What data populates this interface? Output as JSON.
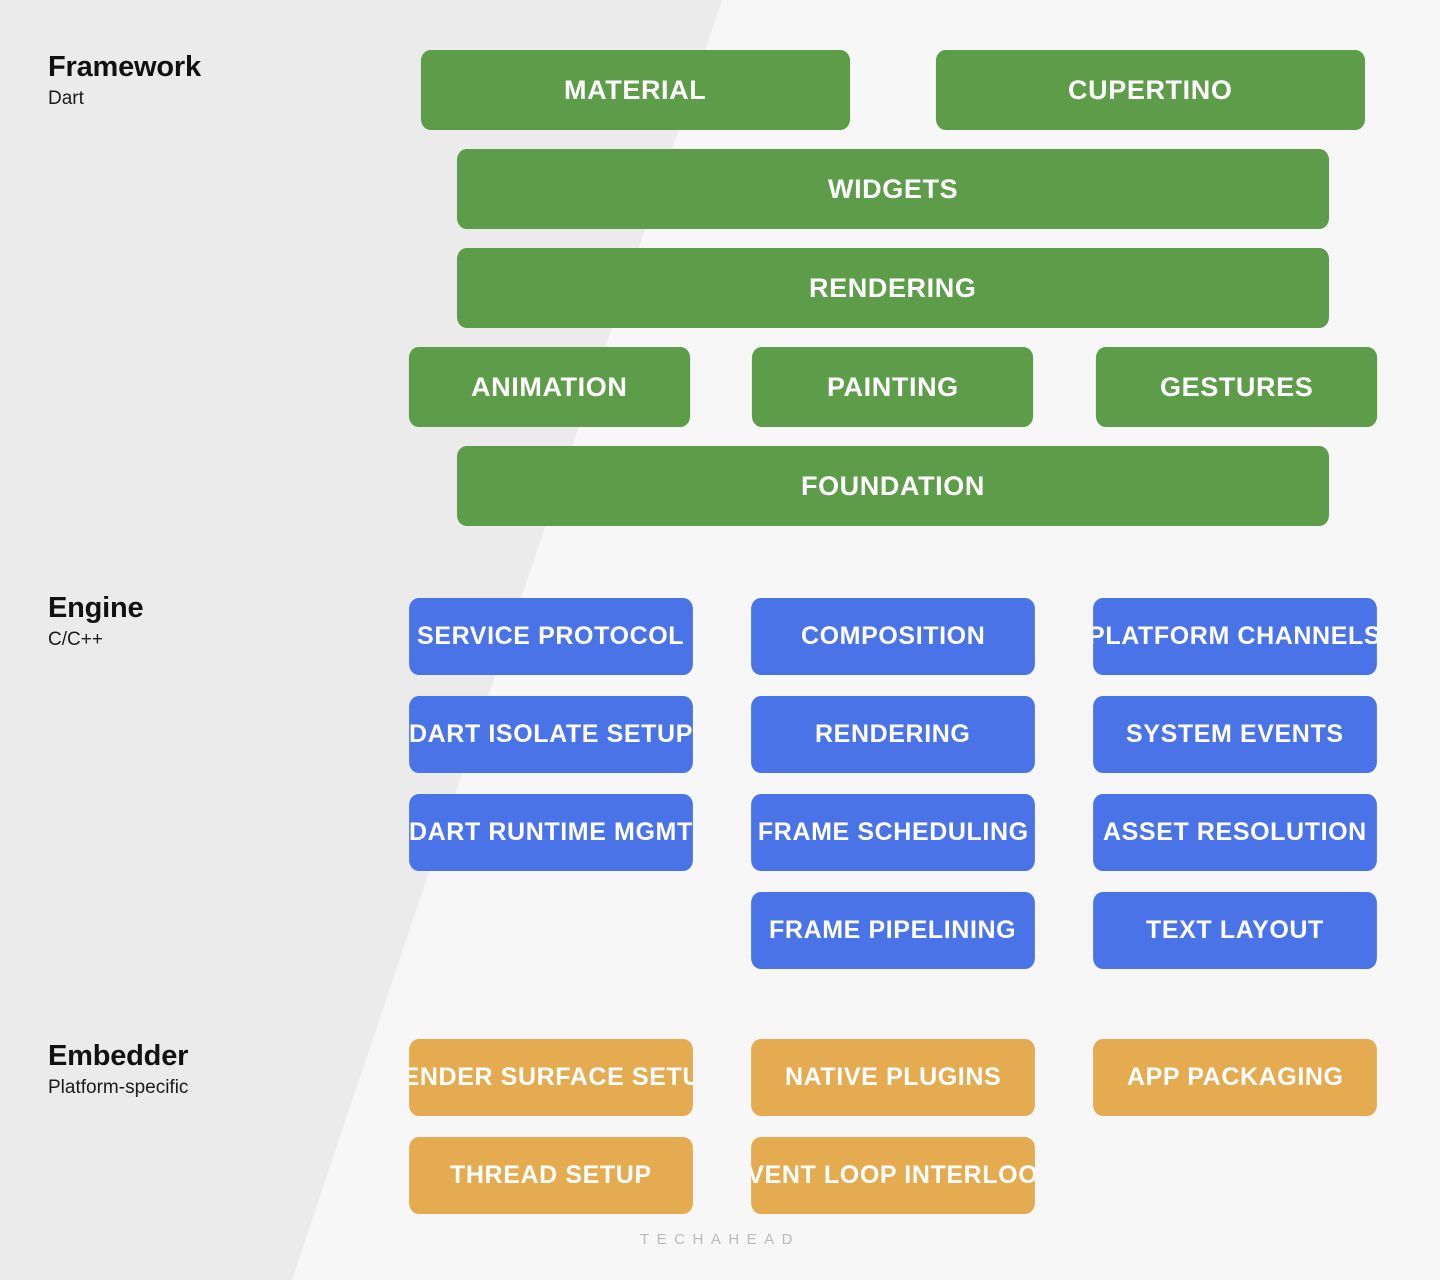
{
  "theme": {
    "bg_left": "#ebebeb",
    "bg_right": "#f7f7f7",
    "framework_color": "#5d9c48",
    "engine_color": "#4a73e8",
    "embedder_color": "#e5ab50",
    "box_text_color": "#ffffff",
    "label_text_color": "#111111",
    "watermark_color": "#b9b9b9"
  },
  "sections": {
    "framework": {
      "title": "Framework",
      "subtitle": "Dart",
      "rows": [
        [
          {
            "label": "MATERIAL",
            "width": "half"
          },
          {
            "label": "CUPERTINO",
            "width": "half"
          }
        ],
        [
          {
            "label": "WIDGETS",
            "width": "full"
          }
        ],
        [
          {
            "label": "RENDERING",
            "width": "full"
          }
        ],
        [
          {
            "label": "ANIMATION",
            "width": "third"
          },
          {
            "label": "PAINTING",
            "width": "third"
          },
          {
            "label": "GESTURES",
            "width": "third"
          }
        ],
        [
          {
            "label": "FOUNDATION",
            "width": "full"
          }
        ]
      ]
    },
    "engine": {
      "title": "Engine",
      "subtitle": "C/C++",
      "rows": [
        [
          {
            "label": "SERVICE PROTOCOL",
            "width": "third"
          },
          {
            "label": "COMPOSITION",
            "width": "third"
          },
          {
            "label": "PLATFORM CHANNELS",
            "width": "third"
          }
        ],
        [
          {
            "label": "DART ISOLATE SETUP",
            "width": "third"
          },
          {
            "label": "RENDERING",
            "width": "third"
          },
          {
            "label": "SYSTEM EVENTS",
            "width": "third"
          }
        ],
        [
          {
            "label": "DART RUNTIME MGMT",
            "width": "third"
          },
          {
            "label": "FRAME SCHEDULING",
            "width": "third"
          },
          {
            "label": "ASSET RESOLUTION",
            "width": "third"
          }
        ],
        [
          {
            "label": "",
            "width": "third",
            "spacer": true
          },
          {
            "label": "FRAME PIPELINING",
            "width": "third"
          },
          {
            "label": "TEXT LAYOUT",
            "width": "third"
          }
        ]
      ]
    },
    "embedder": {
      "title": "Embedder",
      "subtitle": "Platform-specific",
      "rows": [
        [
          {
            "label": "RENDER SURFACE SETUP",
            "width": "third"
          },
          {
            "label": "NATIVE PLUGINS",
            "width": "third"
          },
          {
            "label": "APP PACKAGING",
            "width": "third"
          }
        ],
        [
          {
            "label": "THREAD SETUP",
            "width": "third"
          },
          {
            "label": "EVENT LOOP INTERLOOP",
            "width": "third"
          }
        ]
      ]
    }
  },
  "watermark": "TECHAHEAD"
}
